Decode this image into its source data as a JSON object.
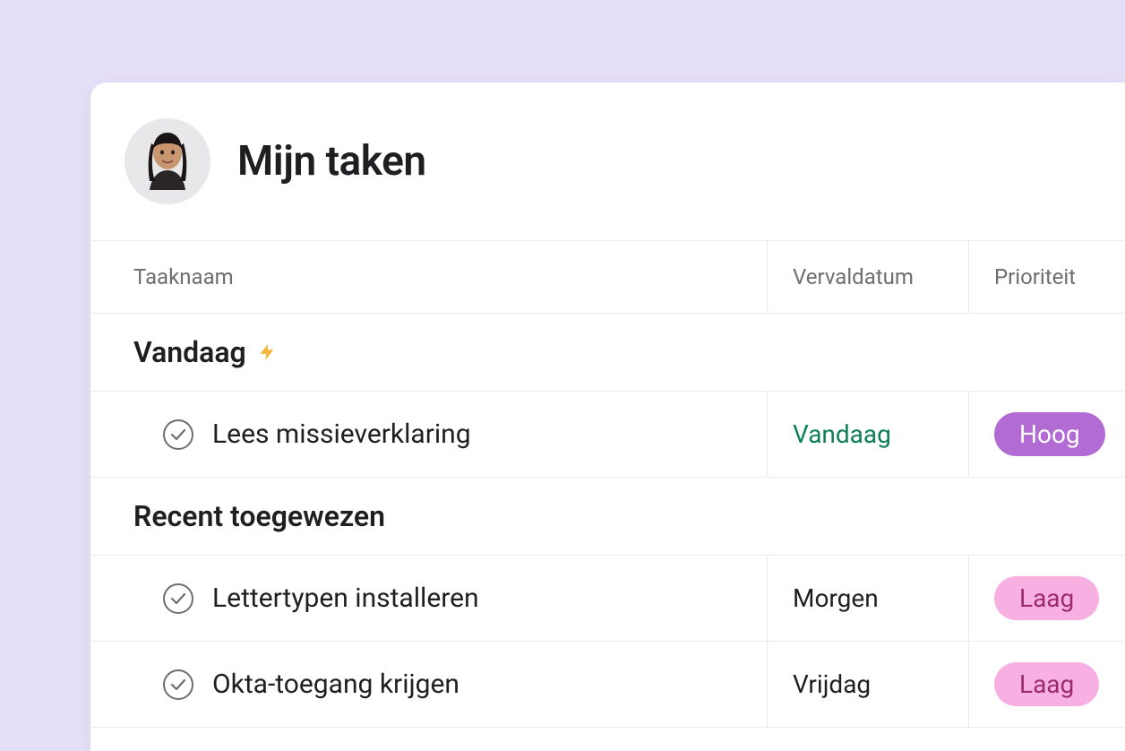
{
  "header": {
    "title": "Mijn taken"
  },
  "columns": {
    "name": "Taaknaam",
    "due": "Vervaldatum",
    "priority": "Prioriteit"
  },
  "sections": [
    {
      "label": "Vandaag",
      "has_bolt": true,
      "tasks": [
        {
          "name": "Lees missieverklaring",
          "due": "Vandaag",
          "due_is_today": true,
          "priority_label": "Hoog",
          "priority_level": "high"
        }
      ]
    },
    {
      "label": "Recent toegewezen",
      "has_bolt": false,
      "tasks": [
        {
          "name": "Lettertypen installeren",
          "due": "Morgen",
          "due_is_today": false,
          "priority_label": "Laag",
          "priority_level": "low"
        },
        {
          "name": "Okta-toegang krijgen",
          "due": "Vrijdag",
          "due_is_today": false,
          "priority_label": "Laag",
          "priority_level": "low"
        }
      ]
    }
  ]
}
